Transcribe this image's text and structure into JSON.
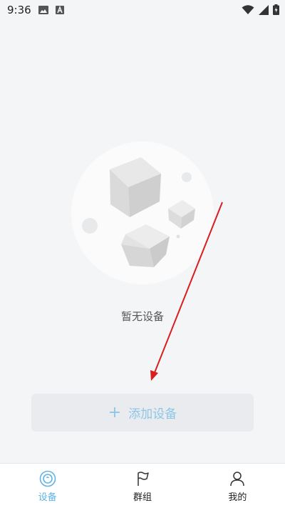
{
  "status_bar": {
    "time": "9:36",
    "left_icons": [
      "image-icon",
      "font-icon"
    ],
    "right_icons": [
      "wifi-icon",
      "signal-icon",
      "battery-icon"
    ]
  },
  "empty_state": {
    "message": "暂无设备"
  },
  "add_device": {
    "plus": "+",
    "label": "添加设备",
    "color": "#8ec6e8"
  },
  "tabbar": {
    "active_color": "#5fb3e6",
    "tabs": [
      {
        "label": "设备",
        "icon": "device-icon",
        "active": true
      },
      {
        "label": "群组",
        "icon": "flag-icon",
        "active": false
      },
      {
        "label": "我的",
        "icon": "person-icon",
        "active": false
      }
    ]
  },
  "annotation": {
    "color": "#d81e1e"
  }
}
